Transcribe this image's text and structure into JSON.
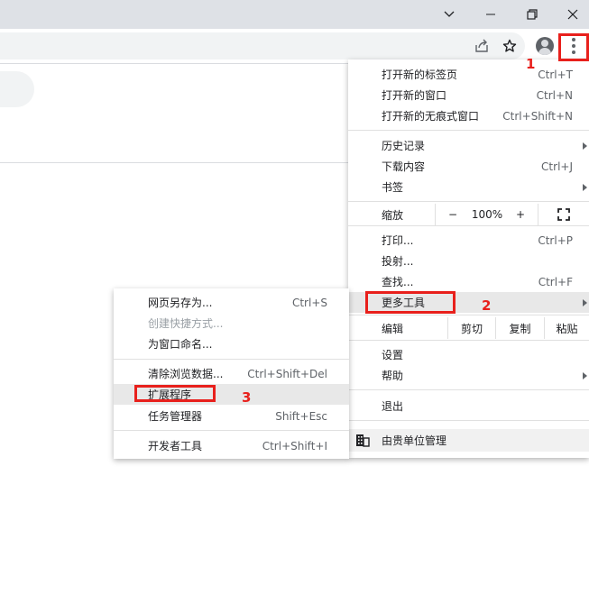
{
  "main_menu": {
    "items_group1": [
      {
        "label": "打开新的标签页",
        "shortcut": "Ctrl+T"
      },
      {
        "label": "打开新的窗口",
        "shortcut": "Ctrl+N"
      },
      {
        "label": "打开新的无痕式窗口",
        "shortcut": "Ctrl+Shift+N"
      }
    ],
    "items_group2": [
      {
        "label": "历史记录",
        "shortcut": ""
      },
      {
        "label": "下载内容",
        "shortcut": "Ctrl+J"
      },
      {
        "label": "书签",
        "shortcut": ""
      }
    ],
    "zoom": {
      "label": "缩放",
      "minus": "−",
      "level": "100%",
      "plus": "+"
    },
    "items_group3": [
      {
        "label": "打印...",
        "shortcut": "Ctrl+P"
      },
      {
        "label": "投射...",
        "shortcut": ""
      },
      {
        "label": "查找...",
        "shortcut": "Ctrl+F"
      },
      {
        "label": "更多工具",
        "shortcut": ""
      }
    ],
    "edit": {
      "label": "编辑",
      "cut": "剪切",
      "copy": "复制",
      "paste": "粘贴"
    },
    "items_group4": [
      {
        "label": "设置",
        "shortcut": ""
      },
      {
        "label": "帮助",
        "shortcut": ""
      }
    ],
    "exit": "退出",
    "managed": "由贵单位管理"
  },
  "sub_menu": {
    "items_group1": [
      {
        "label": "网页另存为...",
        "shortcut": "Ctrl+S"
      },
      {
        "label": "创建快捷方式...",
        "shortcut": ""
      },
      {
        "label": "为窗口命名...",
        "shortcut": ""
      }
    ],
    "items_group2": [
      {
        "label": "清除浏览数据...",
        "shortcut": "Ctrl+Shift+Del"
      },
      {
        "label": "扩展程序",
        "shortcut": ""
      },
      {
        "label": "任务管理器",
        "shortcut": "Shift+Esc"
      }
    ],
    "items_group3": [
      {
        "label": "开发者工具",
        "shortcut": "Ctrl+Shift+I"
      }
    ]
  },
  "annotations": {
    "step1": "1",
    "step2": "2",
    "step3": "3"
  },
  "colors": {
    "highlight": "#e8201c",
    "titlebar": "#dee1e6"
  }
}
